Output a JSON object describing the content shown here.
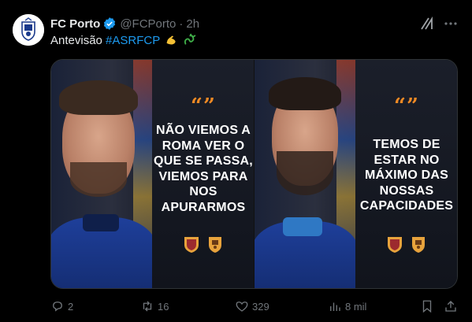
{
  "author": {
    "display_name": "FC Porto",
    "handle": "@FCPorto",
    "separator": "·",
    "time": "2h"
  },
  "tweet": {
    "text": "Antevisão",
    "hashtag": "#ASRFCP",
    "emojis": [
      "flexed-biceps",
      "dragon"
    ]
  },
  "media": {
    "panels": [
      {
        "quote_marks": "“”",
        "quote": "NÃO VIEMOS A ROMA VER O QUE SE PASSA, VIEMOS PARA NOS APURARMOS"
      },
      {
        "quote_marks": "“”",
        "quote": "TEMOS DE ESTAR NO MÁXIMO DAS NOSSAS CAPACIDADES"
      }
    ]
  },
  "actions": {
    "replies": "2",
    "reposts": "16",
    "likes": "329",
    "views": "8 mil"
  },
  "icons": {
    "verified": "verified-badge-icon",
    "grok": "grok-icon",
    "more": "more-icon",
    "reply": "reply-icon",
    "repost": "repost-icon",
    "like": "heart-icon",
    "views": "views-icon",
    "bookmark": "bookmark-icon",
    "share": "share-icon"
  },
  "colors": {
    "background": "#000000",
    "text": "#e7e9ea",
    "muted": "#71767b",
    "accent": "#1d9bf0",
    "quote_orange": "#f08a24"
  }
}
